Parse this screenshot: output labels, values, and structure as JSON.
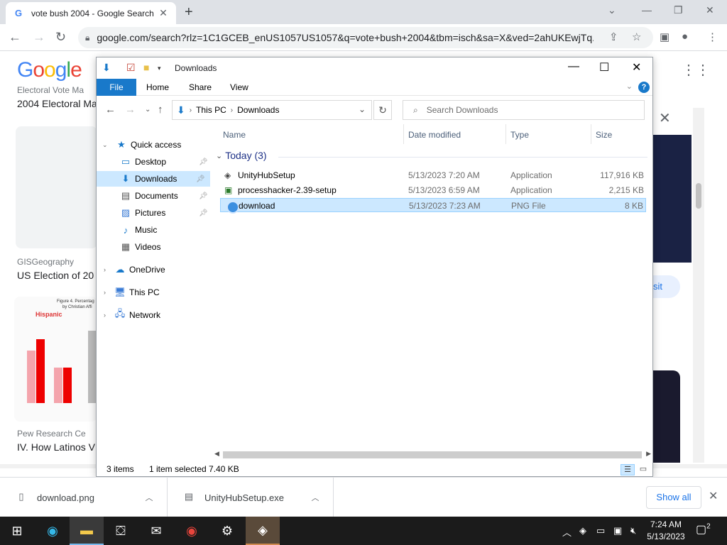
{
  "browser": {
    "tab_title": "vote bush 2004 - Google Search",
    "tab_favicon": "G",
    "url": "google.com/search?rlz=1C1GCEB_enUS1057US1057&q=vote+bush+2004&tbm=isch&sa=X&ved=2ahUKEwjTq..."
  },
  "google": {
    "logo": [
      "G",
      "o",
      "o",
      "g",
      "l",
      "e"
    ],
    "results": [
      {
        "source": "Electoral Vote Ma",
        "title": "2004 Electoral Ma"
      },
      {
        "source": "GISGeography",
        "title": "US Election of 20"
      },
      {
        "source": "Pew Research Ce",
        "title": "IV. How Latinos V"
      }
    ],
    "chart_caption": "Figure 4.  Percentag",
    "chart_sub": "by Christian Affi",
    "chart_label": "Hispanic",
    "visit_label": "sit"
  },
  "explorer": {
    "title": "Downloads",
    "ribbon": {
      "file": "File",
      "home": "Home",
      "share": "Share",
      "view": "View",
      "help": "?"
    },
    "address": {
      "root": "This PC",
      "current": "Downloads"
    },
    "search_placeholder": "Search Downloads",
    "nav": {
      "quick_access": "Quick access",
      "desktop": "Desktop",
      "downloads": "Downloads",
      "documents": "Documents",
      "pictures": "Pictures",
      "music": "Music",
      "videos": "Videos",
      "onedrive": "OneDrive",
      "thispc": "This PC",
      "network": "Network"
    },
    "columns": {
      "name": "Name",
      "date": "Date modified",
      "type": "Type",
      "size": "Size"
    },
    "group": "Today (3)",
    "files": [
      {
        "name": "UnityHubSetup",
        "date": "5/13/2023 7:20 AM",
        "type": "Application",
        "size": "117,916 KB"
      },
      {
        "name": "processhacker-2.39-setup",
        "date": "5/13/2023 6:59 AM",
        "type": "Application",
        "size": "2,215 KB"
      },
      {
        "name": "download",
        "date": "5/13/2023 7:23 AM",
        "type": "PNG File",
        "size": "8 KB"
      }
    ],
    "status": {
      "count": "3 items",
      "selected": "1 item selected  7.40 KB"
    }
  },
  "downloads_shelf": {
    "items": [
      {
        "name": "download.png"
      },
      {
        "name": "UnityHubSetup.exe"
      }
    ],
    "show_all": "Show all"
  },
  "taskbar": {
    "time": "7:24 AM",
    "date": "5/13/2023",
    "notifications": "2"
  },
  "colors": {
    "accent": "#1979ca",
    "selection": "#cce8ff",
    "taskbar": "#1b1b1b"
  }
}
